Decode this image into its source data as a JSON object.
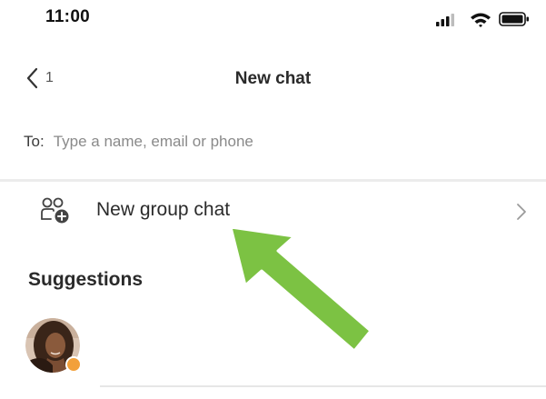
{
  "status_bar": {
    "time": "11:00",
    "icons": [
      "signal-icon",
      "wifi-icon",
      "battery-icon"
    ]
  },
  "nav": {
    "back_count": "1",
    "title": "New chat"
  },
  "recipient": {
    "label": "To:",
    "placeholder": "Type a name, email or phone",
    "value": ""
  },
  "group_chat": {
    "label": "New group chat",
    "icon": "group-add-icon"
  },
  "suggestions": {
    "heading": "Suggestions",
    "items": [
      {
        "avatar": "avatar-photo",
        "presence": "away"
      }
    ]
  },
  "annotation": {
    "arrow_color": "#7cc243",
    "arrow_outline": "#ffffff"
  },
  "colors": {
    "background": "#ffffff",
    "text_primary": "#2a2a2a",
    "text_secondary": "#8a8a8a",
    "divider": "#ececec",
    "presence_away": "#f2a03a"
  }
}
